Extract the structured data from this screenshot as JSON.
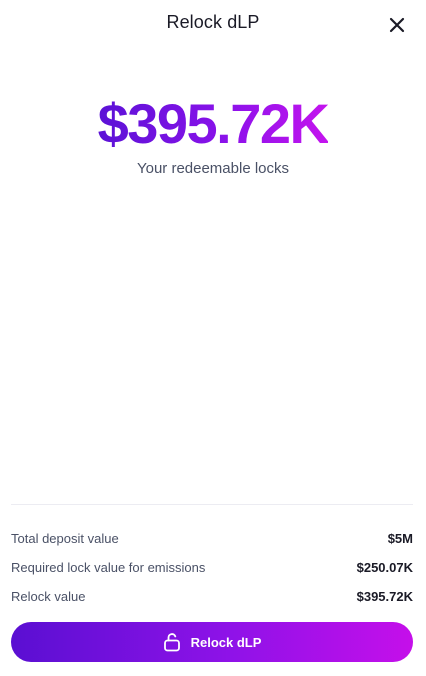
{
  "header": {
    "title": "Relock dLP"
  },
  "hero": {
    "amount": "$395.72K",
    "caption": "Your redeemable locks"
  },
  "summary": [
    {
      "label": "Total deposit value",
      "value": "$5M"
    },
    {
      "label": "Required lock value for emissions",
      "value": "$250.07K"
    },
    {
      "label": "Relock value",
      "value": "$395.72K"
    }
  ],
  "action": {
    "label": "Relock dLP",
    "icon": "unlock-icon"
  },
  "colors": {
    "gradient_start": "#5a0fd2",
    "gradient_end": "#c50fea",
    "text_primary": "#1a1a26",
    "text_secondary": "#4a5166"
  }
}
